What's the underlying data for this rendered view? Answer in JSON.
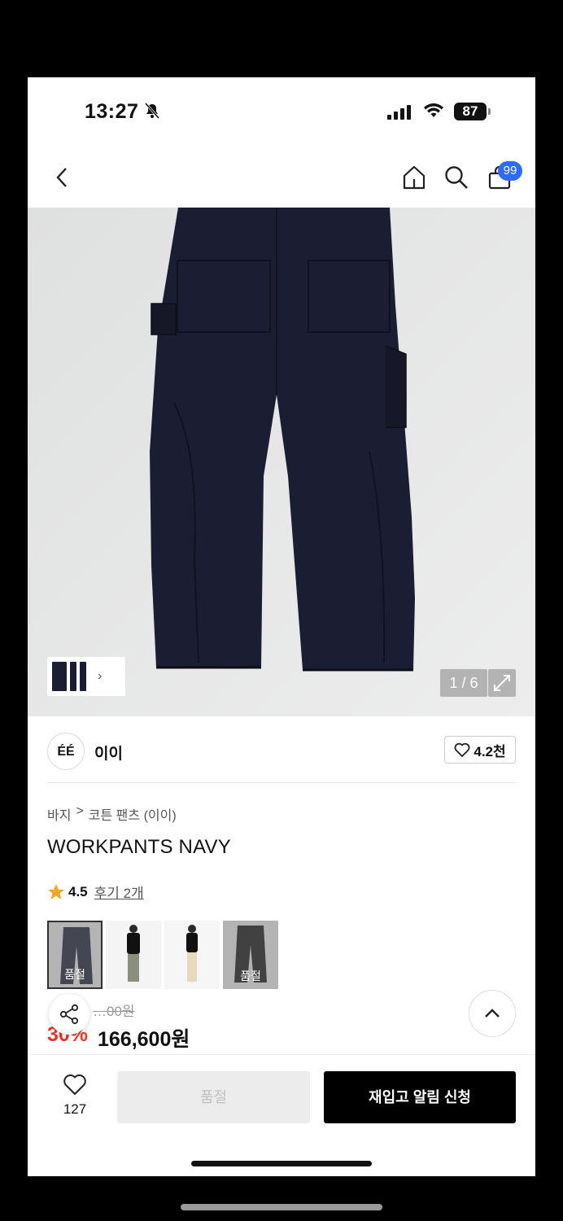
{
  "status_bar": {
    "time": "13:27",
    "battery": "87"
  },
  "navbar": {
    "cart_count": "99"
  },
  "gallery": {
    "counter": "1 / 6"
  },
  "brand": {
    "logo_text": "ÉÉ",
    "name": "이이",
    "likes": "4.2천"
  },
  "breadcrumb": {
    "category": "바지",
    "separator": ">",
    "subcategory": "코튼 팬츠 (이이)"
  },
  "product": {
    "title": "WORKPANTS NAVY",
    "rating": "4.5",
    "reviews_label": "후기 2개",
    "original_price": "…00원",
    "discount": "30%",
    "price": "166,600원"
  },
  "swatches": [
    {
      "label": "품절",
      "sold_out": true
    },
    {
      "label": "",
      "sold_out": false
    },
    {
      "label": "",
      "sold_out": false
    },
    {
      "label": "품절",
      "sold_out": true
    }
  ],
  "bottom_bar": {
    "wish_count": "127",
    "soldout_label": "품절",
    "restock_label": "재입고 알림 신청"
  },
  "colors": {
    "accent": "#2f6bff",
    "discount": "#e4372a",
    "pants": "#1b1e33"
  }
}
